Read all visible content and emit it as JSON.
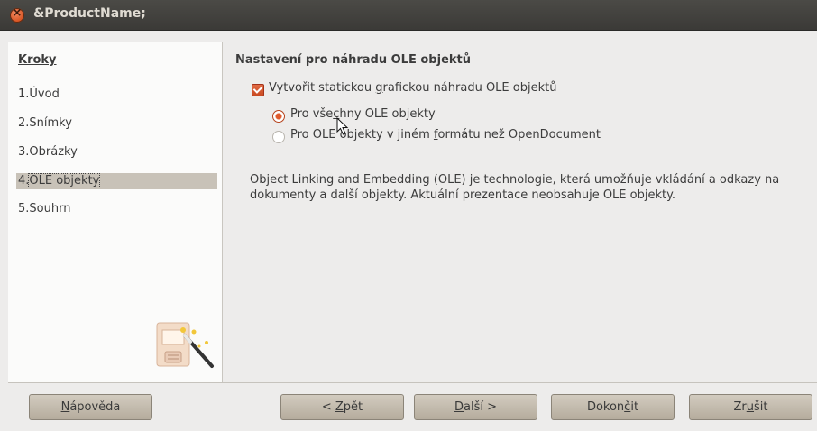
{
  "window": {
    "title": "&ProductName;"
  },
  "sidebar": {
    "title": "Kroky",
    "steps": [
      {
        "num": "1.",
        "label": "Úvod"
      },
      {
        "num": "2.",
        "label": "Snímky"
      },
      {
        "num": "3.",
        "label": "Obrázky"
      },
      {
        "num": "4.",
        "label": "OLE objekty"
      },
      {
        "num": "5.",
        "label": "Souhrn"
      }
    ],
    "active_step": 4
  },
  "main": {
    "title": "Nastavení pro náhradu OLE objektů",
    "checkbox": {
      "pre": "Vytvořit statickou ",
      "u": "g",
      "post": "rafickou náhradu OLE objektů",
      "checked": true
    },
    "radio_all": {
      "pre": "Pro vše",
      "u": "c",
      "post": "hny OLE objekty",
      "selected": true
    },
    "radio_other": {
      "pre": "Pro OLE objekty v jiném ",
      "u": "f",
      "post": "ormátu než OpenDocument",
      "selected": false
    },
    "description": "Object Linking and Embedding (OLE) je technologie, která umožňuje vkládání a odkazy na dokumenty a další objekty. Aktuální prezentace neobsahuje OLE objekty."
  },
  "buttons": {
    "help": {
      "u": "N",
      "post": "ápověda"
    },
    "back": {
      "pre": "< ",
      "u": "Z",
      "post": "pět"
    },
    "next": {
      "u": "D",
      "post": "alší >"
    },
    "finish": {
      "pre": "Dokon",
      "u": "č",
      "post": "it"
    },
    "cancel": {
      "pre": "Zr",
      "u": "u",
      "post": "šit"
    }
  }
}
